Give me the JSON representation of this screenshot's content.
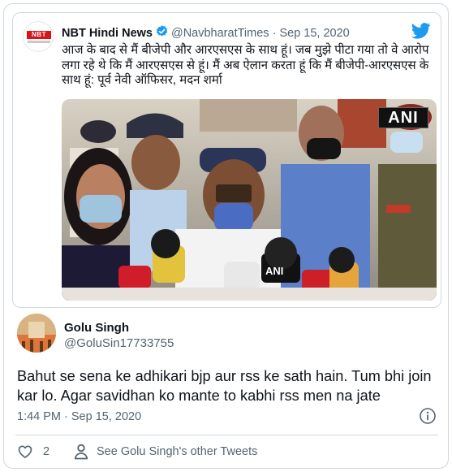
{
  "quoted_tweet": {
    "author_name": "NBT Hindi News",
    "handle": "@NavbharatTimes",
    "separator": "·",
    "date": "Sep 15, 2020",
    "avatar_logo": "NBT",
    "text": "आज के बाद से मैं बीजेपी और आरएसएस के साथ हूं। जब मुझे पीटा गया तो वे आरोप लगा रहे थे कि मैं आरएसएस से हूं। मैं अब ऐलान करता हूं कि मैं बीजेपी-आरएसएस के साथ हूं: पूर्व नेवी ऑफिसर, मदन शर्मा",
    "image_watermark": "ANI",
    "mic_labels": [
      "ANI"
    ]
  },
  "tweet": {
    "author_name": "Golu Singh",
    "handle": "@GoluSin17733755",
    "text": "Bahut se sena ke adhikari bjp aur rss ke sath hain. Tum bhi join kar lo. Agar savidhan ko mante to kabhi rss men na jate",
    "timestamp": "1:44 PM · Sep 15, 2020"
  },
  "actions": {
    "like_count": "2",
    "profile_link": "See Golu Singh's other Tweets"
  },
  "icons": {
    "verified": "verified-badge-icon",
    "brand": "twitter-bird-icon",
    "info": "info-icon",
    "like": "heart-icon",
    "profile": "person-icon"
  },
  "colors": {
    "brand_blue": "#1d9bf0",
    "text_primary": "#0f1419",
    "text_secondary": "#536471",
    "border": "#cfd9de",
    "nbt_red": "#d7141a"
  }
}
